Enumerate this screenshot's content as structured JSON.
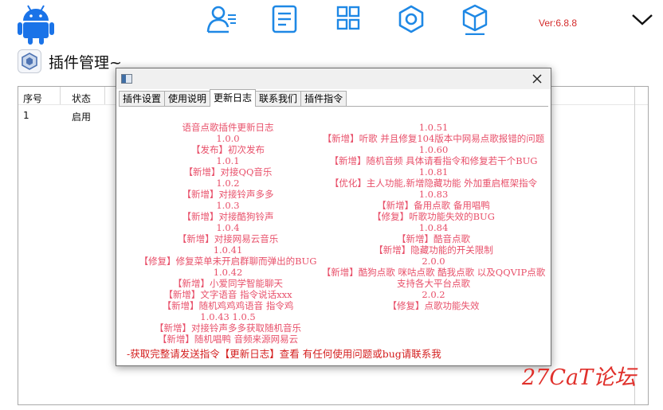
{
  "version_label": "Ver:6.8.8",
  "top_icons": [
    "android-icon",
    "user-list-icon",
    "document-icon",
    "grid-icon",
    "gear-icon",
    "cube-icon",
    "chevron-down-icon"
  ],
  "plugin_header": {
    "title": "插件管理~"
  },
  "table": {
    "headers": [
      "序号",
      "状态"
    ],
    "rows": [
      [
        "1",
        "启用"
      ]
    ]
  },
  "dialog": {
    "tabs": [
      "插件设置",
      "使用说明",
      "更新日志",
      "联系我们",
      "插件指令"
    ],
    "active_tab": "更新日志",
    "changelog_left": [
      "语音点歌插件更新日志",
      "1.0.0",
      "【发布】初次发布",
      "1.0.1",
      "【新增】对接QQ音乐",
      "1.0.2",
      "【新增】对接铃声多多",
      "1.0.3",
      "【新增】对接酷狗铃声",
      "1.0.4",
      "【新增】对接网易云音乐",
      "1.0.41",
      "【修复】修复菜单未开启群聊而弹出的BUG",
      "1.0.42",
      "【新增】小爱同学智能聊天",
      "【新增】文字语音 指令说话xxx",
      "【新增】随机鸡鸡鸡语音 指令鸡",
      "1.0.43 1.0.5",
      "【新增】对接铃声多多获取随机音乐",
      "【新增】随机唱鸭 音频来源网易云"
    ],
    "changelog_right": [
      "1.0.51",
      "【新增】听歌 并且修复104版本中网易点歌报错的问题",
      "1.0.60",
      "【新增】随机音频 具体请看指令和修复若干个BUG",
      "1.0.81",
      "【优化】主人功能,新增隐藏功能 外加重启框架指令",
      "1.0.83",
      "【新增】备用点歌 备用唱鸭",
      "【修复】听歌功能失效的BUG",
      "1.0.84",
      "【新增】酷音点歌",
      "【新增】隐藏功能的开关限制",
      "2.0.0",
      "【新增】酷狗点歌 咪咕点歌 酷我点歌 以及QQVIP点歌 支持各大平台点歌",
      "2.0.2",
      "【修复】点歌功能失效"
    ],
    "footer": "-获取完整请发送指令【更新日志】查看 有任何使用问题或bug请联系我"
  },
  "watermark_text": "27CaT论坛",
  "colors": {
    "accent_blue": "#1e88e5",
    "android_blue": "#1a73e8",
    "changelog_pink": "#e8506a",
    "footer_red": "#d41e1e",
    "version_red": "#d42b2b"
  }
}
